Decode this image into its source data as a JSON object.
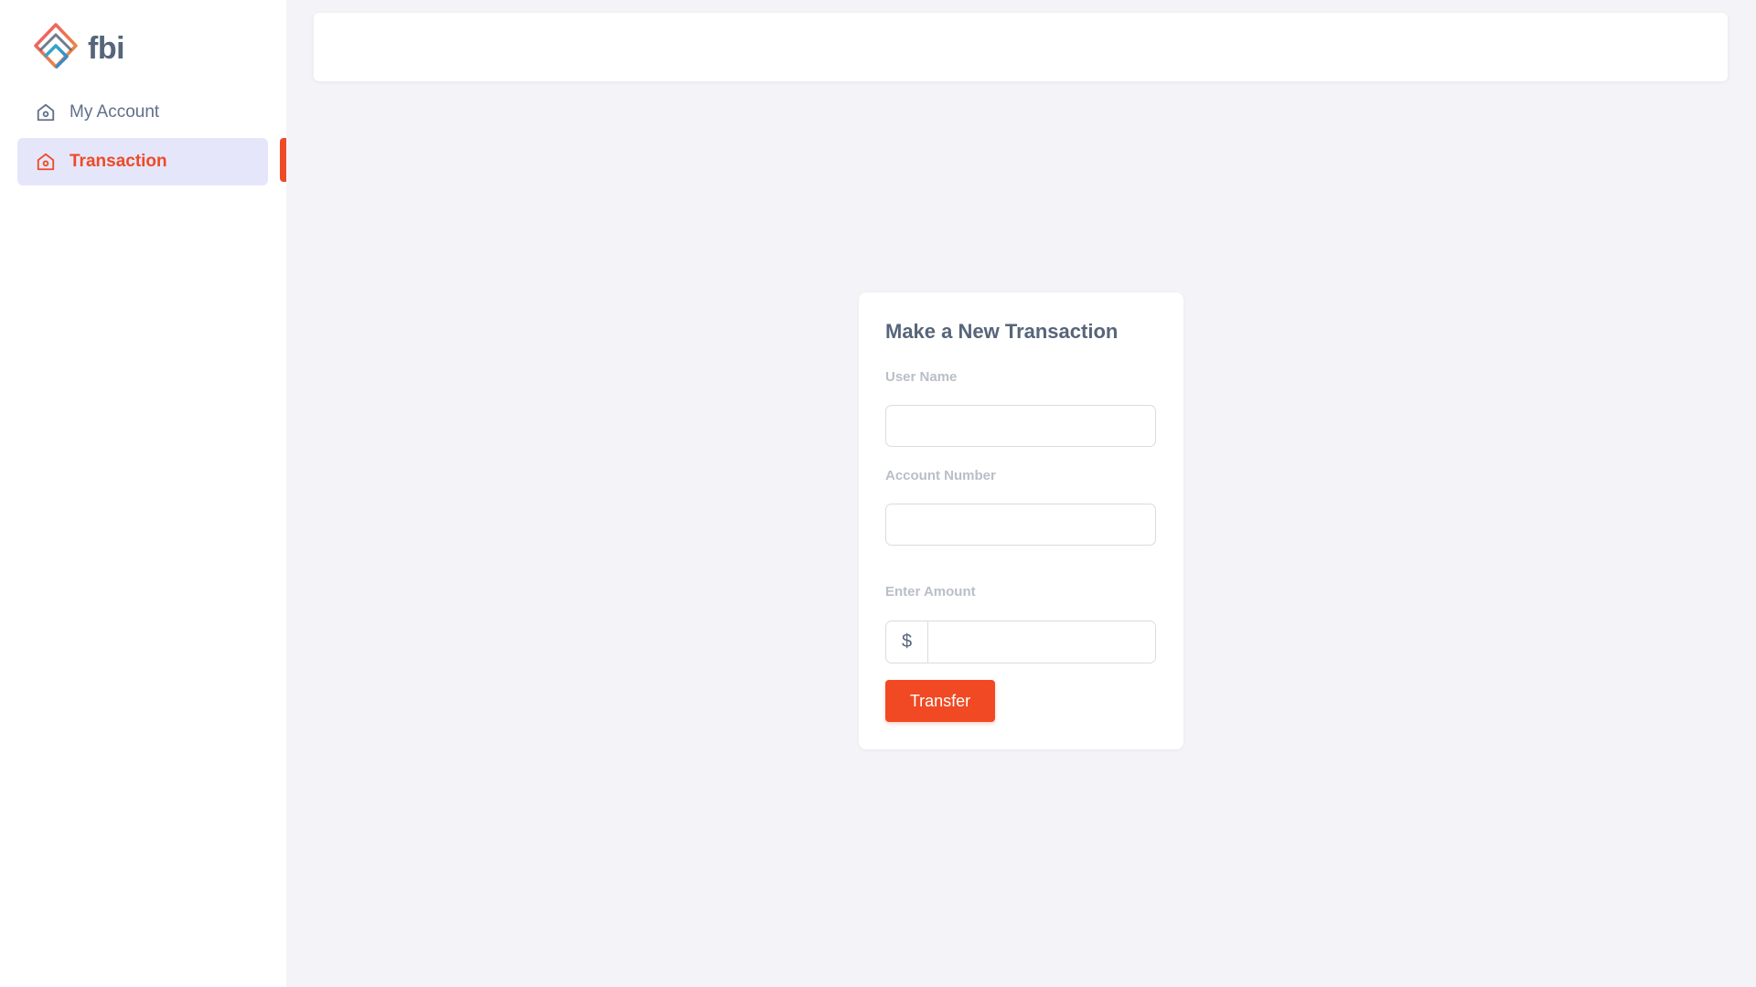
{
  "app": {
    "brand": "fbi",
    "accent_color": "#f04923",
    "text_color": "#56657a"
  },
  "sidebar": {
    "items": [
      {
        "label": "My Account",
        "icon": "home-icon",
        "active": false
      },
      {
        "label": "Transaction",
        "icon": "home-icon",
        "active": true
      }
    ]
  },
  "transaction_form": {
    "title": "Make a New Transaction",
    "user_name_label": "User Name",
    "user_name_value": "",
    "account_number_label": "Account Number",
    "account_number_value": "",
    "amount_label": "Enter Amount",
    "currency_symbol": "$",
    "amount_value": "",
    "submit_label": "Transfer"
  }
}
